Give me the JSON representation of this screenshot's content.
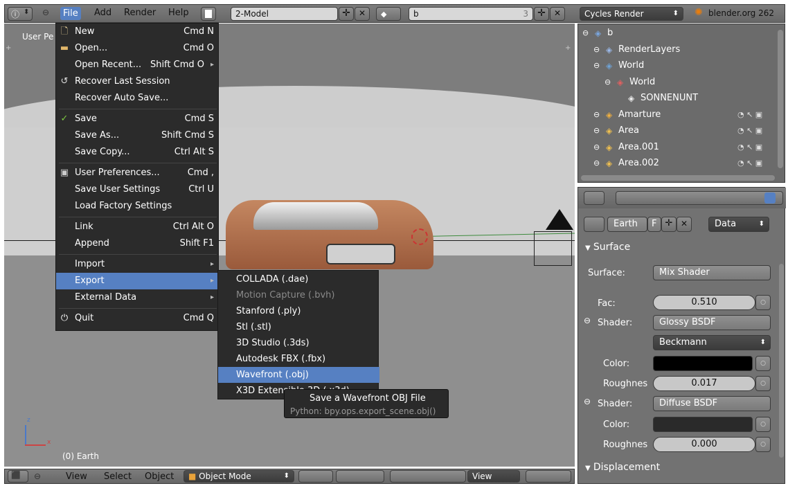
{
  "topbar": {
    "menus": [
      "File",
      "Add",
      "Render",
      "Help"
    ],
    "screen_layout": "2-Model",
    "scene": "b",
    "scene_count": "3",
    "render_engine": "Cycles Render",
    "version_text": "blender.org 262"
  },
  "viewport": {
    "view_label": "User Pe",
    "object_label": "(0) Earth"
  },
  "file_menu": {
    "items": [
      {
        "label": "New",
        "shortcut": "Cmd N",
        "icon": "new-file-icon"
      },
      {
        "label": "Open...",
        "shortcut": "Cmd O",
        "icon": "folder-icon"
      },
      {
        "label": "Open Recent...",
        "shortcut": "Shift Cmd O",
        "icon": "",
        "submenu": true
      },
      {
        "label": "Recover Last Session",
        "shortcut": "",
        "icon": "recover-icon"
      },
      {
        "label": "Recover Auto Save...",
        "shortcut": "",
        "icon": ""
      },
      {
        "label": "Save",
        "shortcut": "Cmd S",
        "icon": "checkmark-icon"
      },
      {
        "label": "Save As...",
        "shortcut": "Shift Cmd S",
        "icon": ""
      },
      {
        "label": "Save Copy...",
        "shortcut": "Ctrl Alt S",
        "icon": ""
      },
      {
        "label": "User Preferences...",
        "shortcut": "Cmd ,",
        "icon": "preferences-icon"
      },
      {
        "label": "Save User Settings",
        "shortcut": "Ctrl U",
        "icon": ""
      },
      {
        "label": "Load Factory Settings",
        "shortcut": "",
        "icon": ""
      },
      {
        "label": "Link",
        "shortcut": "Ctrl Alt O",
        "icon": ""
      },
      {
        "label": "Append",
        "shortcut": "Shift F1",
        "icon": ""
      },
      {
        "label": "Import",
        "shortcut": "",
        "icon": "",
        "submenu": true
      },
      {
        "label": "Export",
        "shortcut": "",
        "icon": "",
        "submenu": true,
        "highlighted": true
      },
      {
        "label": "External Data",
        "shortcut": "",
        "icon": "",
        "submenu": true
      },
      {
        "label": "Quit",
        "shortcut": "Cmd Q",
        "icon": "power-icon"
      }
    ]
  },
  "export_menu": {
    "items": [
      {
        "label": "COLLADA (.dae)"
      },
      {
        "label": "Motion Capture (.bvh)",
        "disabled": true
      },
      {
        "label": "Stanford (.ply)"
      },
      {
        "label": "Stl (.stl)"
      },
      {
        "label": "3D Studio (.3ds)"
      },
      {
        "label": "Autodesk FBX (.fbx)"
      },
      {
        "label": "Wavefront (.obj)",
        "highlighted": true
      },
      {
        "label": "X3D Extensible 3D (.x3d)"
      }
    ]
  },
  "tooltip": {
    "title": "Save a Wavefront OBJ File",
    "python": "Python: bpy.ops.export_scene.obj()"
  },
  "outliner": {
    "items": [
      {
        "label": "b",
        "indent": 0
      },
      {
        "label": "RenderLayers",
        "indent": 1
      },
      {
        "label": "World",
        "indent": 1
      },
      {
        "label": "World",
        "indent": 2
      },
      {
        "label": "SONNENUNT",
        "indent": 3
      },
      {
        "label": "Amarture",
        "indent": 1
      },
      {
        "label": "Area",
        "indent": 1
      },
      {
        "label": "Area.001",
        "indent": 1
      },
      {
        "label": "Area.002",
        "indent": 1
      }
    ]
  },
  "properties": {
    "material_name": "Earth",
    "material_flag": "F",
    "data_dropdown": "Data",
    "surface_section": "Surface",
    "surface_label": "Surface:",
    "surface_value": "Mix Shader",
    "fac_label": "Fac:",
    "fac_value": "0.510",
    "shader1_label": "Shader:",
    "shader1_value": "Glossy BSDF",
    "distribution": "Beckmann",
    "color1_label": "Color:",
    "roughness1_label": "Roughnes",
    "roughness1_value": "0.017",
    "shader2_label": "Shader:",
    "shader2_value": "Diffuse BSDF",
    "color2_label": "Color:",
    "roughness2_label": "Roughnes",
    "roughness2_value": "0.000",
    "displacement_section": "Displacement"
  },
  "bottombar": {
    "view": "View",
    "select": "Select",
    "object": "Object",
    "mode": "Object Mode",
    "view2": "View"
  },
  "colors": {
    "accent": "#5680c2",
    "menu_bg": "#2b2b2b",
    "panel_bg": "#727272"
  }
}
